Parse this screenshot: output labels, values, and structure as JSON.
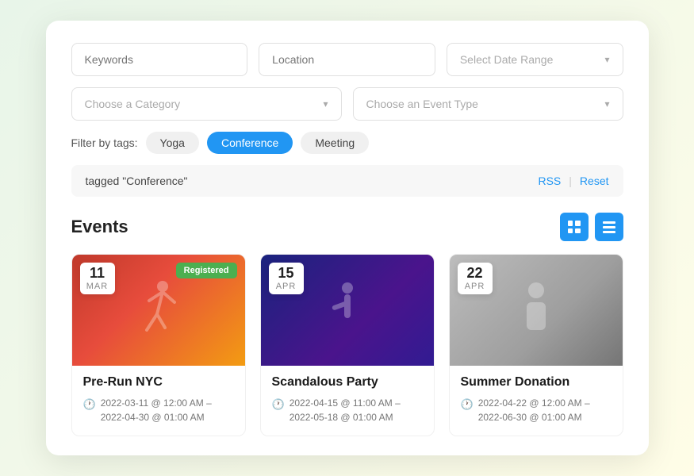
{
  "search": {
    "keywords_placeholder": "Keywords",
    "location_placeholder": "Location",
    "date_range_placeholder": "Select Date Range",
    "category_placeholder": "Choose a Category",
    "event_type_placeholder": "Choose an Event Type"
  },
  "tags": {
    "label": "Filter by tags:",
    "items": [
      {
        "id": "yoga",
        "label": "Yoga",
        "active": false
      },
      {
        "id": "conference",
        "label": "Conference",
        "active": true
      },
      {
        "id": "meeting",
        "label": "Meeting",
        "active": false
      }
    ]
  },
  "tagged_bar": {
    "text": "tagged \"Conference\"",
    "rss_label": "RSS",
    "separator": "|",
    "reset_label": "Reset"
  },
  "events_section": {
    "title": "Events",
    "view_grid_label": "Grid view",
    "view_list_label": "List view",
    "items": [
      {
        "day": "11",
        "month": "MAR",
        "registered": true,
        "registered_label": "Registered",
        "name": "Pre-Run NYC",
        "time": "2022-03-11 @ 12:00 AM – 2022-04-30 @ 01:00 AM",
        "img_type": "running"
      },
      {
        "day": "15",
        "month": "APR",
        "registered": false,
        "name": "Scandalous Party",
        "time": "2022-04-15 @ 11:00 AM – 2022-05-18 @ 01:00 AM",
        "img_type": "concert"
      },
      {
        "day": "22",
        "month": "APR",
        "registered": false,
        "name": "Summer Donation",
        "time": "2022-04-22 @ 12:00 AM – 2022-06-30 @ 01:00 AM",
        "img_type": "donation"
      }
    ]
  }
}
